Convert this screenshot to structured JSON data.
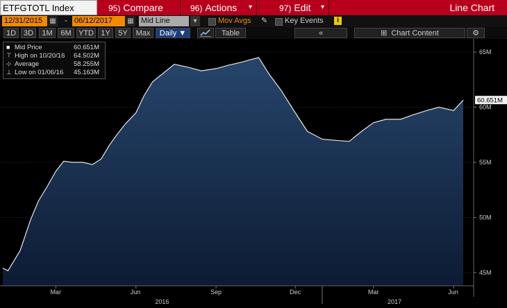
{
  "toolbar": {
    "ticker": "ETFGTOTL Index",
    "compare": {
      "num": "95)",
      "label": "Compare"
    },
    "actions": {
      "num": "96)",
      "label": "Actions"
    },
    "edit": {
      "num": "97)",
      "label": "Edit"
    },
    "view_title": "Line Chart"
  },
  "dates": {
    "start": "12/31/2015",
    "sep": "-",
    "end": "06/12/2017"
  },
  "options": {
    "mode": "Mid Line",
    "mov_avgs": "Mov Avgs",
    "key_events": "Key Events"
  },
  "periods": [
    "1D",
    "3D",
    "1M",
    "6M",
    "YTD",
    "1Y",
    "5Y",
    "Max"
  ],
  "frequency": "Daily ▼",
  "table_label": "Table",
  "collapse_label": "«",
  "chart_content_label": "Chart Content",
  "legend": [
    {
      "label": "Mid Price",
      "value": "60.651M"
    },
    {
      "label": "High on 10/20/16",
      "value": "64.502M"
    },
    {
      "label": "Average",
      "value": "58.255M"
    },
    {
      "label": "Low on 01/06/16",
      "value": "45.163M"
    }
  ],
  "chart_data": {
    "type": "area",
    "series": [
      {
        "name": "Mid Price",
        "x": [
          "2015-12-31",
          "2016-01-06",
          "2016-01-20",
          "2016-02-01",
          "2016-02-10",
          "2016-02-20",
          "2016-03-01",
          "2016-03-10",
          "2016-03-20",
          "2016-04-01",
          "2016-04-12",
          "2016-04-22",
          "2016-05-01",
          "2016-05-10",
          "2016-05-20",
          "2016-06-01",
          "2016-06-10",
          "2016-06-20",
          "2016-07-01",
          "2016-07-15",
          "2016-08-01",
          "2016-08-15",
          "2016-09-01",
          "2016-09-15",
          "2016-10-01",
          "2016-10-10",
          "2016-10-20",
          "2016-11-01",
          "2016-11-15",
          "2016-12-01",
          "2016-12-15",
          "2017-01-01",
          "2017-01-15",
          "2017-02-01",
          "2017-02-15",
          "2017-03-01",
          "2017-03-15",
          "2017-04-01",
          "2017-04-15",
          "2017-05-01",
          "2017-05-15",
          "2017-06-01",
          "2017-06-12"
        ],
        "y": [
          45.4,
          45.163,
          47.0,
          49.8,
          51.5,
          52.8,
          54.2,
          55.1,
          55.0,
          55.0,
          54.8,
          55.3,
          56.5,
          57.5,
          58.5,
          59.5,
          61.0,
          62.3,
          63.0,
          63.9,
          63.6,
          63.3,
          63.5,
          63.8,
          64.1,
          64.3,
          64.502,
          63.0,
          61.5,
          59.5,
          57.8,
          57.1,
          57.0,
          56.9,
          57.8,
          58.6,
          58.9,
          58.9,
          59.3,
          59.7,
          60.0,
          59.7,
          60.651
        ]
      }
    ],
    "x_ticks": [
      "Mar",
      "Jun",
      "Sep",
      "Dec",
      "Mar",
      "Jun"
    ],
    "x_years": [
      "2016",
      "2017"
    ],
    "y_ticks": [
      "45M",
      "50M",
      "55M",
      "60M",
      "65M"
    ],
    "ylim": [
      43.8,
      66.2
    ],
    "last_value_label": "60.651M",
    "colors": {
      "line": "#e8e8e8",
      "fill_top": "#27456b",
      "fill_bottom": "#0c1b33",
      "label_bg": "#f2f2f2"
    }
  }
}
